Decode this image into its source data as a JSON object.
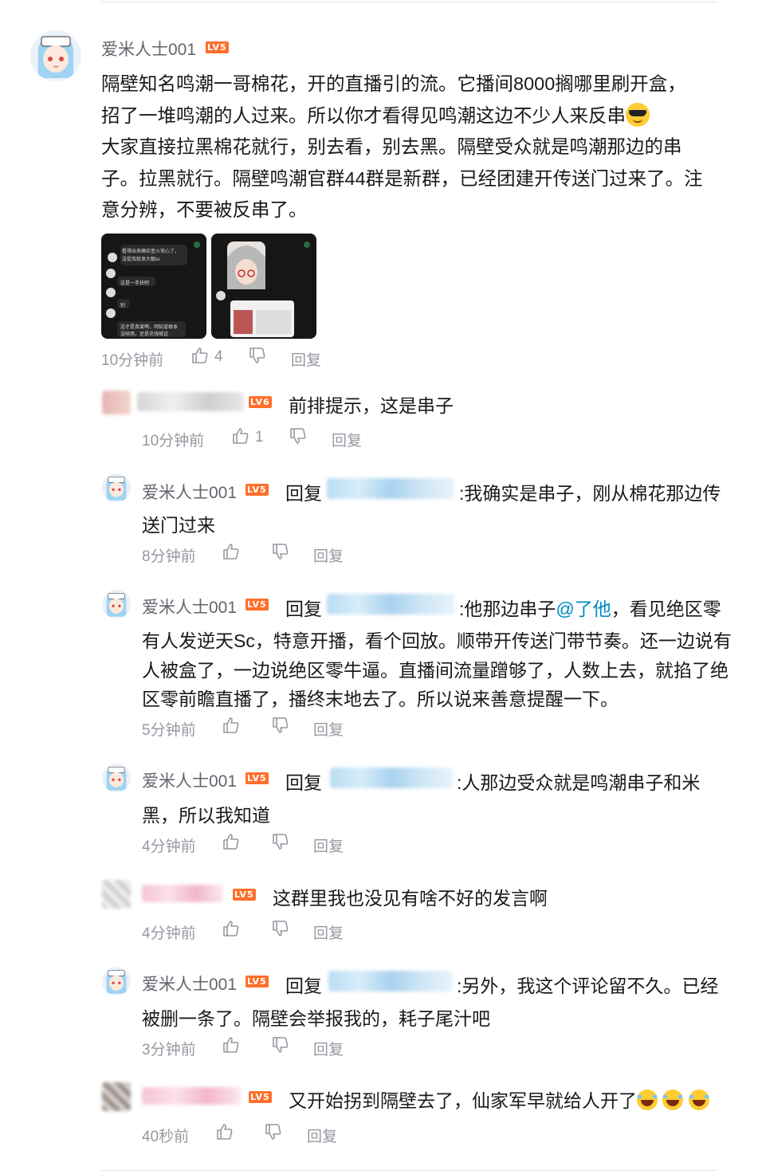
{
  "main": {
    "username": "爱米人士001",
    "level": "LV5",
    "text_lines": [
      "隔壁知名鸣潮一哥棉花，开的直播引的流。它播间8000搁哪里刷开盒，",
      "招了一堆鸣潮的人过来。所以你才看得见鸣潮这边不少人来反串",
      "大家直接拉黑棉花就行，别去看，别去黑。隔壁受众就是鸣潮那边的串",
      "子。拉黑就行。隔壁鸣潮官群44群是新群，已经团建开传送门过来了。注",
      "意分辨，不要被反串了。"
    ],
    "thumb1_lines": [
      "看得出来确实查火攻心了，",
      "没捉虫就发大额sc",
      "这是一手抉吧",
      "别",
      "这才是真爱啊，明知道根本",
      "没啥用，还是花钱喊话"
    ],
    "time": "10分钟前",
    "likes": "4",
    "reply_label": "回复"
  },
  "replies": [
    {
      "kind": "other",
      "level": "LV6",
      "text": "前排提示，这是串子",
      "time": "10分钟前",
      "likes": "1",
      "reply_label": "回复"
    },
    {
      "kind": "self",
      "username": "爱米人士001",
      "level": "LV5",
      "reply_prefix": "回复",
      "text_a": ":我确实是串子，刚从棉花那边传",
      "text_b": "送门过来",
      "time": "8分钟前",
      "reply_label": "回复"
    },
    {
      "kind": "self",
      "username": "爱米人士001",
      "level": "LV5",
      "reply_prefix": "回复",
      "text_a": ":他那边串子",
      "mention": "@了他",
      "text_a2": "，看见绝区零",
      "lines": [
        "有人发逆天Sc，特意开播，看个回放。顺带开传送门带节奏。还一边说有",
        "人被盒了，一边说绝区零牛逼。直播间流量蹭够了，人数上去，就掐了绝",
        "区零前瞻直播了，播终末地去了。所以说来善意提醒一下。"
      ],
      "time": "5分钟前",
      "reply_label": "回复"
    },
    {
      "kind": "self",
      "username": "爱米人士001",
      "level": "LV5",
      "reply_prefix": "回复",
      "text_a": ":人那边受众就是鸣潮串子和米",
      "text_b": "黑，所以我知道",
      "time": "4分钟前",
      "reply_label": "回复"
    },
    {
      "kind": "other",
      "level": "LV5",
      "text": "这群里我也没见有啥不好的发言啊",
      "time": "4分钟前",
      "reply_label": "回复"
    },
    {
      "kind": "self",
      "username": "爱米人士001",
      "level": "LV5",
      "reply_prefix": "回复",
      "text_a": ":另外，我这个评论留不久。已经",
      "text_b": "被删一条了。隔壁会举报我的，耗子尾汁吧",
      "time": "3分钟前",
      "reply_label": "回复"
    },
    {
      "kind": "other",
      "level": "LV5",
      "text": "又开始拐到隔壁去了，仙家军早就给人开了",
      "time": "40秒前",
      "reply_label": "回复"
    }
  ],
  "colors": {
    "level_badge": "#ff6f2b",
    "mention": "#008ac5",
    "meta": "#9499a0",
    "username": "#61666d"
  }
}
